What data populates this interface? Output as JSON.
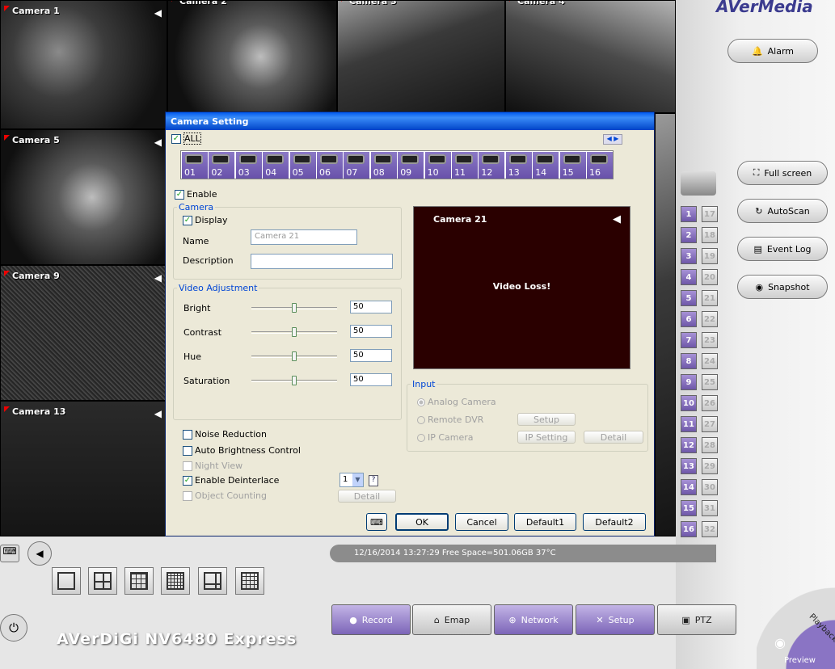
{
  "cameras": {
    "tiles": [
      {
        "label": "Camera 1"
      },
      {
        "label": "Camera 2"
      },
      {
        "label": "Camera 3"
      },
      {
        "label": "Camera 4"
      },
      {
        "label": "Camera 5"
      },
      {
        "label": "Camera 9"
      },
      {
        "label": "Camera 13"
      }
    ]
  },
  "brand": {
    "logo": "AVerMedia",
    "product": "AVerDiGi NV6480 Express"
  },
  "right_panel": {
    "alarm": "Alarm",
    "full_screen": "Full screen",
    "autoscan": "AutoScan",
    "event_log": "Event Log",
    "snapshot": "Snapshot",
    "channels_left": [
      "1",
      "2",
      "3",
      "4",
      "5",
      "6",
      "7",
      "8",
      "9",
      "10",
      "11",
      "12",
      "13",
      "14",
      "15",
      "16"
    ],
    "channels_right": [
      "17",
      "18",
      "19",
      "20",
      "21",
      "22",
      "23",
      "24",
      "25",
      "26",
      "27",
      "28",
      "29",
      "30",
      "31",
      "32"
    ]
  },
  "status_bar": {
    "text": "12/16/2014 13:27:29  Free Space=501.06GB 37°C"
  },
  "function_buttons": [
    {
      "label": "Record",
      "icon": "record-icon"
    },
    {
      "label": "Emap",
      "icon": "emap-icon"
    },
    {
      "label": "Network",
      "icon": "network-icon"
    },
    {
      "label": "Setup",
      "icon": "setup-icon"
    },
    {
      "label": "PTZ",
      "icon": "ptz-icon"
    }
  ],
  "mode_dial": {
    "preview": "Preview",
    "playback": "Playback"
  },
  "dialog": {
    "title": "Camera Setting",
    "all_label": "ALL",
    "camera_numbers": [
      "01",
      "02",
      "03",
      "04",
      "05",
      "06",
      "07",
      "08",
      "09",
      "10",
      "11",
      "12",
      "13",
      "14",
      "15",
      "16"
    ],
    "enable_label": "Enable",
    "camera_group": "Camera",
    "display_label": "Display",
    "name_label": "Name",
    "name_value": "Camera 21",
    "description_label": "Description",
    "description_value": "",
    "video_adjustment_group": "Video Adjustment",
    "adjustments": [
      {
        "label": "Bright",
        "value": "50"
      },
      {
        "label": "Contrast",
        "value": "50"
      },
      {
        "label": "Hue",
        "value": "50"
      },
      {
        "label": "Saturation",
        "value": "50"
      }
    ],
    "preview_camera": "Camera 21",
    "preview_status": "Video Loss!",
    "input_group": "Input",
    "input_analog": "Analog Camera",
    "input_remote": "Remote DVR",
    "input_ip": "IP Camera",
    "setup_btn": "Setup",
    "ip_setting_btn": "IP Setting",
    "detail_btn": "Detail",
    "noise_reduction": "Noise Reduction",
    "auto_brightness": "Auto Brightness Control",
    "night_view": "Night View",
    "enable_deinterlace": "Enable Deinterlace",
    "deinterlace_value": "1",
    "object_counting": "Object Counting",
    "object_detail_btn": "Detail",
    "ok": "OK",
    "cancel": "Cancel",
    "default1": "Default1",
    "default2": "Default2"
  }
}
